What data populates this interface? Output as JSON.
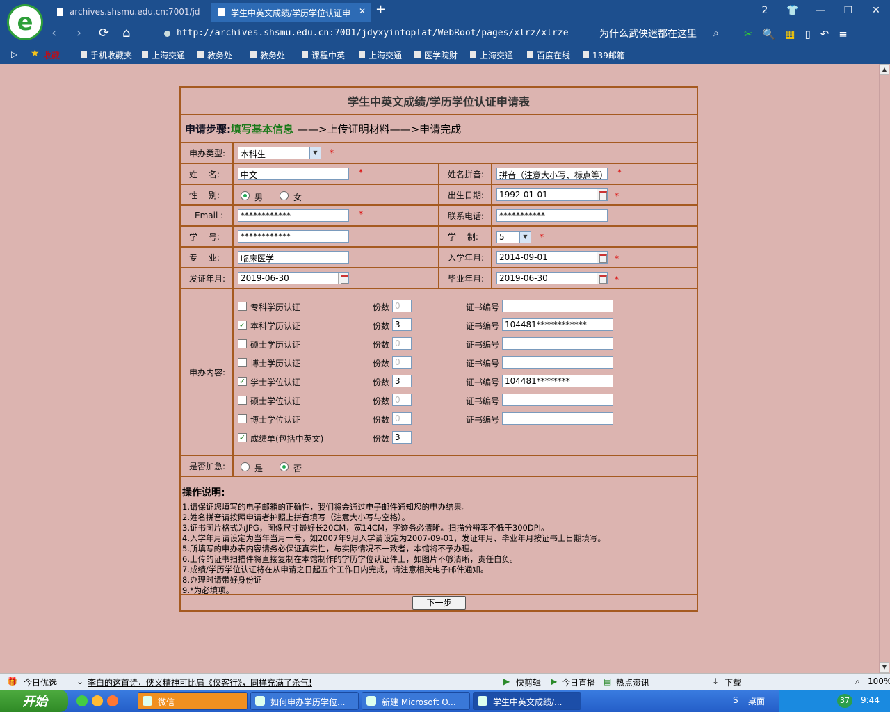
{
  "browser": {
    "tabs": [
      {
        "label": "archives.shsmu.edu.cn:7001/jd"
      },
      {
        "label": "学生中英文成绩/学历学位认证申"
      }
    ],
    "url": "http://archives.shsmu.edu.cn:7001/jdyxyinfoplat/WebRoot/pages/xlrz/xlrze",
    "hot_search": "为什么武侠迷都在这里",
    "tab_count": "2",
    "bookmarks": [
      "收藏",
      "手机收藏夹",
      "上海交通",
      "教务处-",
      "教务处-",
      "课程中英",
      "上海交通",
      "医学院财",
      "上海交通",
      "百度在线",
      "139邮箱"
    ]
  },
  "form": {
    "title": "学生中英文成绩/学历学位认证申请表",
    "steps": {
      "prefix": "申请步骤:",
      "current": "填写基本信息",
      "rest": "——>上传证明材料——>申请完成"
    },
    "type_label": "申办类型:",
    "type_value": "本科生",
    "name_label": "姓　 名:",
    "name_value": "中文",
    "pinyin_label": "姓名拼音:",
    "pinyin_value": "拼音（注意大小写、标点等）",
    "gender_label": "性　 别:",
    "gender_male": "男",
    "gender_female": "女",
    "birth_label": "出生日期:",
    "birth_value": "1992-01-01",
    "email_label": "Email :",
    "email_value": "************",
    "phone_label": "联系电话:",
    "phone_value": "***********",
    "sid_label": "学　 号:",
    "sid_value": "************",
    "duration_label": "学　 制:",
    "duration_value": "5",
    "major_label": "专　 业:",
    "major_value": "临床医学",
    "enroll_label": "入学年月:",
    "enroll_value": "2014-09-01",
    "issue_label": "发证年月:",
    "issue_value": "2019-06-30",
    "grad_label": "毕业年月:",
    "grad_value": "2019-06-30",
    "content_label": "申办内容:",
    "copies_label": "份数",
    "cert_label": "证书编号",
    "items": [
      {
        "name": "专科学历认证",
        "checked": false,
        "copies": "0",
        "cert": ""
      },
      {
        "name": "本科学历认证",
        "checked": true,
        "copies": "3",
        "cert": "104481************"
      },
      {
        "name": "硕士学历认证",
        "checked": false,
        "copies": "0",
        "cert": ""
      },
      {
        "name": "博士学历认证",
        "checked": false,
        "copies": "0",
        "cert": ""
      },
      {
        "name": "学士学位认证",
        "checked": true,
        "copies": "3",
        "cert": "104481********"
      },
      {
        "name": "硕士学位认证",
        "checked": false,
        "copies": "0",
        "cert": ""
      },
      {
        "name": "博士学位认证",
        "checked": false,
        "copies": "0",
        "cert": ""
      },
      {
        "name": "成绩单(包括中英文)",
        "checked": true,
        "copies": "3"
      }
    ],
    "urgent_label": "是否加急:",
    "urgent_yes": "是",
    "urgent_no": "否",
    "notes_title": "操作说明:",
    "notes": [
      "1.请保证您填写的电子邮箱的正确性，我们将会通过电子邮件通知您的申办结果。",
      "2.姓名拼音请按照申请者护照上拼音填写（注意大小写与空格）。",
      "3.证书图片格式为JPG，图像尺寸最好长20CM，宽14CM，字迹务必清晰。扫描分辨率不低于300DPI。",
      "4.入学年月请设定为当年当月一号，如2007年9月入学请设定为2007-09-01，发证年月、毕业年月按证书上日期填写。",
      "5.所填写的申办表内容请务必保证真实性，与实际情况不一致者，本馆将不予办理。",
      "6.上传的证书扫描件将直接复制在本馆制作的学历学位认证件上，如图片不够清晰，责任自负。",
      "7.成绩/学历学位认证将在从申请之日起五个工作日内完成，请注意相关电子邮件通知。",
      "8.办理时请带好身份证",
      "9.*为必填项。"
    ],
    "next_button": "下一步"
  },
  "statusbar": {
    "today": "今日优选",
    "news": "李白的这首诗，侠义精神可比肩《侠客行》，同样充满了杀气!",
    "quick_cut": "快剪辑",
    "live": "今日直播",
    "hot": "热点资讯",
    "download": "下载",
    "zoom": "100%"
  },
  "taskbar": {
    "start": "开始",
    "items": [
      "微信",
      "如何申办学历学位...",
      "新建 Microsoft O...",
      "学生中英文成绩/..."
    ],
    "desktop": "桌面",
    "time": "9:44",
    "badge": "37"
  }
}
